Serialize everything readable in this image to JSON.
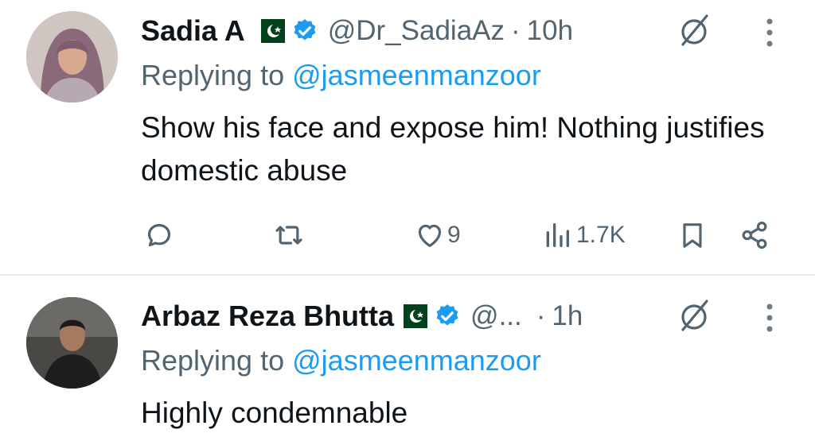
{
  "tweets": [
    {
      "name": "Sadia A",
      "handle": "@Dr_SadiaAz",
      "separator": "·",
      "time": "10h",
      "reply_prefix": "Replying to",
      "reply_to": "@jasmeenmanzoor",
      "text": "Show his face and expose him! Nothing justifies domestic abuse",
      "likes": "9",
      "views": "1.7K"
    },
    {
      "name": "Arbaz Reza Bhutta",
      "handle": "@...",
      "separator": "·",
      "time": "1h",
      "reply_prefix": "Replying to",
      "reply_to": "@jasmeenmanzoor",
      "text": "Highly condemnable"
    }
  ],
  "colors": {
    "text": "#0f1419",
    "muted": "#536471",
    "link": "#1d9bf0",
    "verified": "#1d9bf0",
    "flag_green": "#01411c"
  },
  "icons": [
    "reply-icon",
    "retweet-icon",
    "like-icon",
    "views-icon",
    "bookmark-icon",
    "share-icon",
    "grok-icon",
    "more-icon",
    "verified-badge-icon",
    "pakistan-flag-icon"
  ]
}
